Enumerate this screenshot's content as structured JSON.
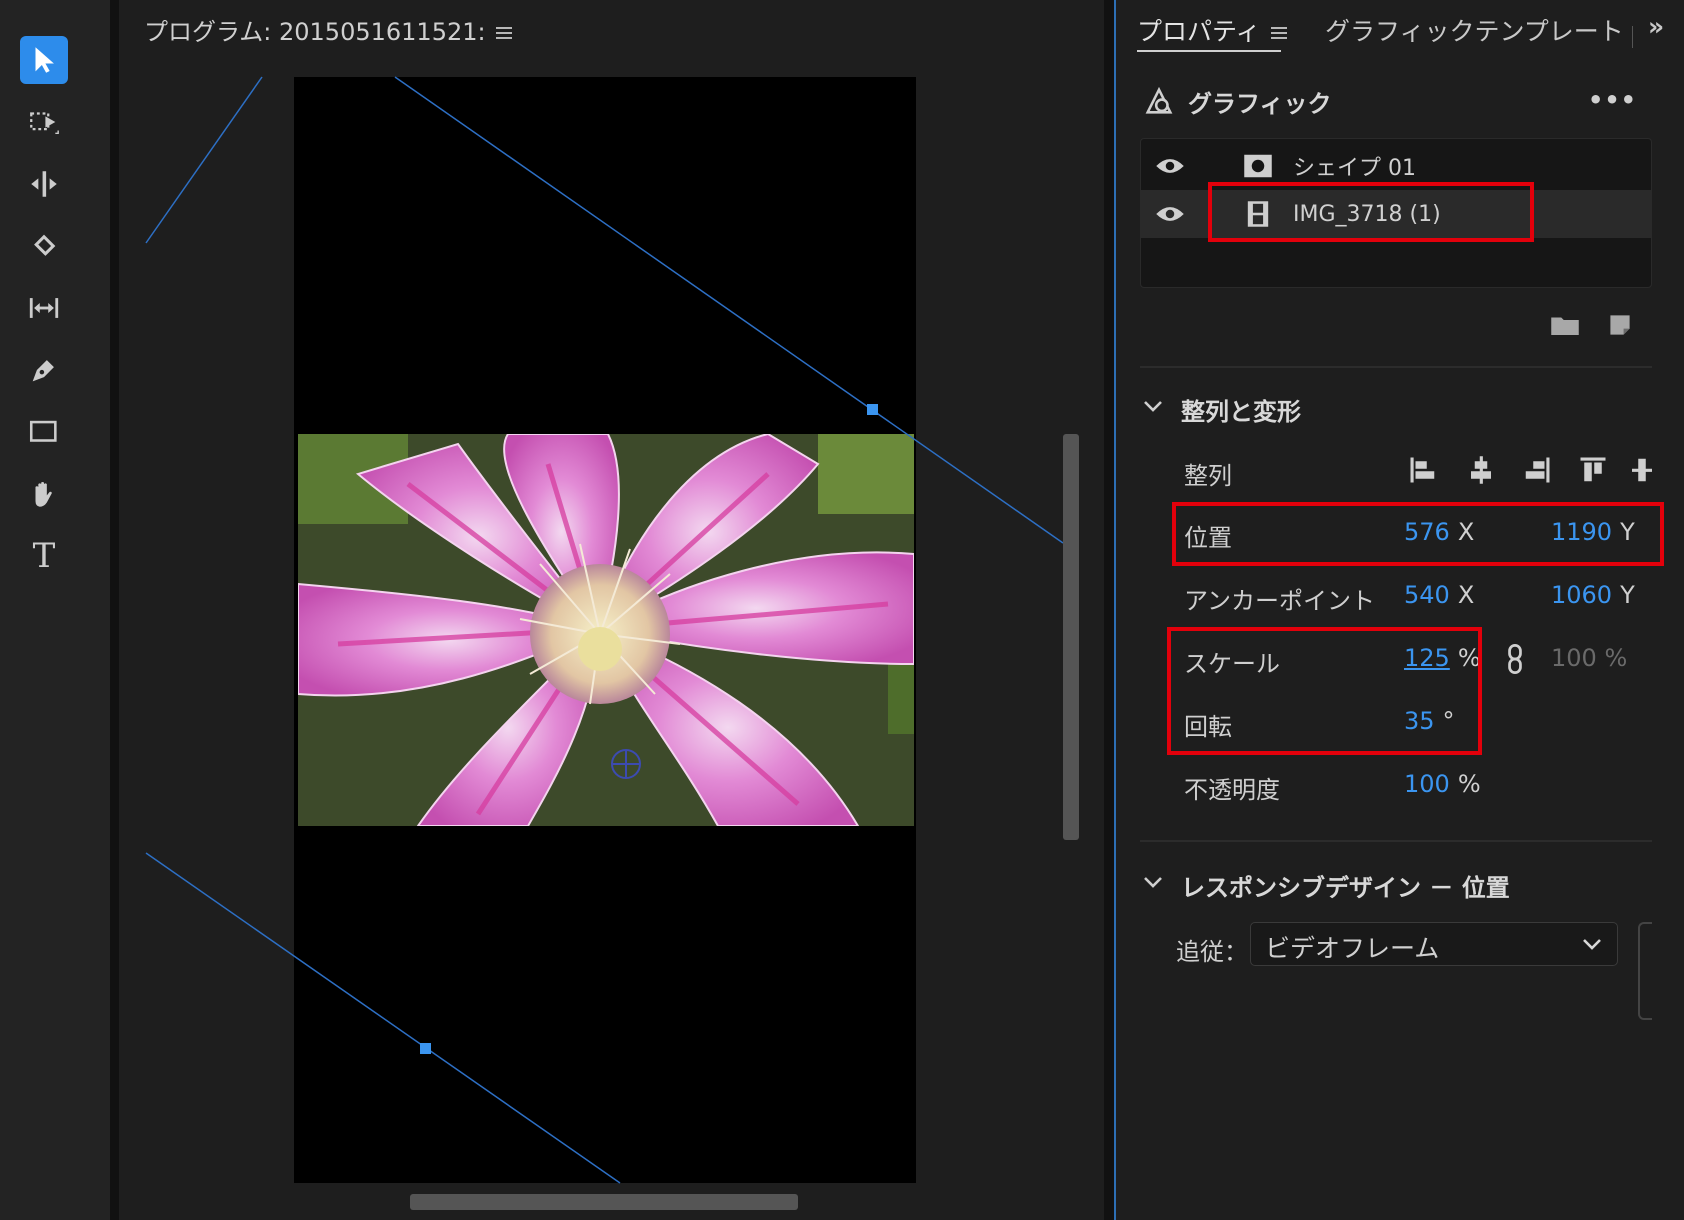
{
  "toolbar": {
    "tools": [
      "selection-tool",
      "track-select-tool",
      "ripple-edit-tool",
      "razor-tool",
      "slip-tool",
      "pen-tool",
      "rectangle-tool",
      "hand-tool",
      "type-tool"
    ],
    "type_glyph": "T"
  },
  "program": {
    "title": "プログラム: 2015051611521:"
  },
  "properties": {
    "tabs": [
      {
        "label": "プロパティ"
      },
      {
        "label": "グラフィックテンプレート"
      }
    ],
    "more_glyph": "»",
    "graphic_title": "グラフィック",
    "layers": [
      {
        "name": "シェイプ 01",
        "icon": "shape-icon"
      },
      {
        "name": "IMG_3718 (1)",
        "icon": "film-icon"
      }
    ],
    "align_transform_title": "整列と変形",
    "align_label": "整列",
    "position": {
      "label": "位置",
      "x": "576",
      "x_unit": "X",
      "y": "1190",
      "y_unit": "Y"
    },
    "anchor": {
      "label": "アンカーポイント",
      "x": "540",
      "x_unit": "X",
      "y": "1060",
      "y_unit": "Y"
    },
    "scale": {
      "label": "スケール",
      "value": "125",
      "unit": "%",
      "linked_value": "100 %"
    },
    "rotation": {
      "label": "回転",
      "value": "35",
      "unit": "°"
    },
    "opacity": {
      "label": "不透明度",
      "value": "100",
      "unit": "%"
    },
    "responsive_title": "レスポンシブデザイン － 位置",
    "follow_label": "追従：",
    "follow_value": "ビデオフレーム"
  },
  "colors": {
    "accent": "#2d8ceb",
    "value_blue": "#3b95f0",
    "highlight_red": "#e3000b"
  }
}
